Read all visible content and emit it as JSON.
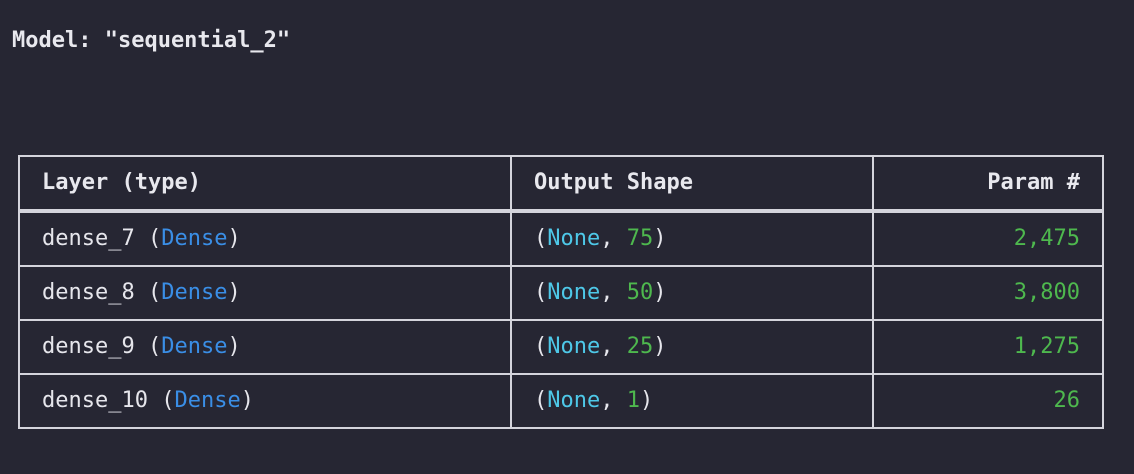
{
  "model": {
    "title": "Model: \"sequential_2\""
  },
  "table": {
    "headers": {
      "layer": "Layer (type)",
      "output_shape": "Output Shape",
      "param": "Param #"
    },
    "rows": [
      {
        "name": "dense_7",
        "type": "Dense",
        "shape_none": "None",
        "shape_dim": "75",
        "params": "2,475"
      },
      {
        "name": "dense_8",
        "type": "Dense",
        "shape_none": "None",
        "shape_dim": "50",
        "params": "3,800"
      },
      {
        "name": "dense_9",
        "type": "Dense",
        "shape_none": "None",
        "shape_dim": "25",
        "params": "1,275"
      },
      {
        "name": "dense_10",
        "type": "Dense",
        "shape_none": "None",
        "shape_dim": "1",
        "params": "26"
      }
    ]
  },
  "colors": {
    "background": "#262633",
    "text": "#e6e6ec",
    "layer_type": "#3a8ee6",
    "none_keyword": "#4ec8e8",
    "number": "#4eb84e",
    "border": "#d4d4dc"
  }
}
